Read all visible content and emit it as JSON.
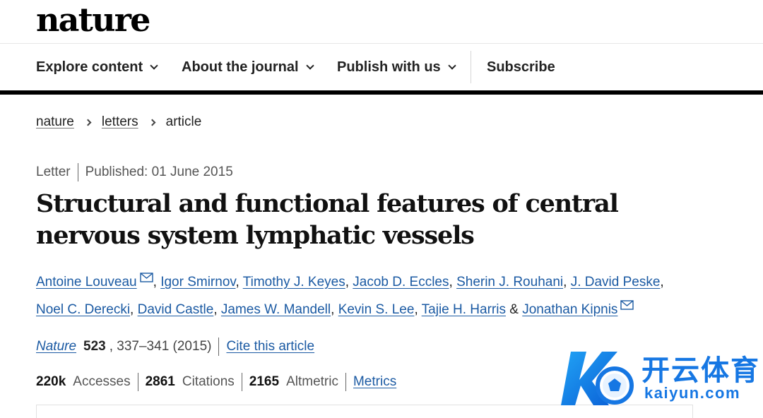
{
  "brand": {
    "logo": "nature"
  },
  "nav": {
    "items": [
      {
        "label": "Explore content",
        "dropdown": true
      },
      {
        "label": "About the journal",
        "dropdown": true
      },
      {
        "label": "Publish with us",
        "dropdown": true
      },
      {
        "label": "Subscribe",
        "dropdown": false
      }
    ]
  },
  "breadcrumb": [
    {
      "label": "nature",
      "link": true
    },
    {
      "label": "letters",
      "link": true
    },
    {
      "label": "article",
      "link": false
    }
  ],
  "article": {
    "type": "Letter",
    "published": "Published: 01 June 2015",
    "title": "Structural and functional features of central nervous system lymphatic vessels",
    "authors": [
      {
        "name": "Antoine Louveau",
        "mail": true
      },
      {
        "name": "Igor Smirnov"
      },
      {
        "name": "Timothy J. Keyes"
      },
      {
        "name": "Jacob D. Eccles"
      },
      {
        "name": "Sherin J. Rouhani"
      },
      {
        "name": "J. David Peske"
      },
      {
        "name": "Noel C. Derecki"
      },
      {
        "name": "David Castle"
      },
      {
        "name": "James W. Mandell"
      },
      {
        "name": "Kevin S. Lee"
      },
      {
        "name": "Tajie H. Harris"
      },
      {
        "name": "Jonathan Kipnis",
        "mail": true
      }
    ],
    "author_separator": ",",
    "author_last_joiner": "&",
    "citation": {
      "journal": "Nature",
      "volume": "523",
      "pages": ", 337–341 (2015)",
      "cite_label": "Cite this article"
    },
    "metrics": {
      "accesses_value": "220k",
      "accesses_label": "Accesses",
      "citations_value": "2861",
      "citations_label": "Citations",
      "altmetric_value": "2165",
      "altmetric_label": "Altmetric",
      "metrics_link": "Metrics"
    }
  },
  "watermark": {
    "brand_text": "开云体育",
    "url_text": "kaiyun.com"
  },
  "colors": {
    "link": "#1b5aa3",
    "text": "#222222",
    "watermark": "#1677e3"
  }
}
